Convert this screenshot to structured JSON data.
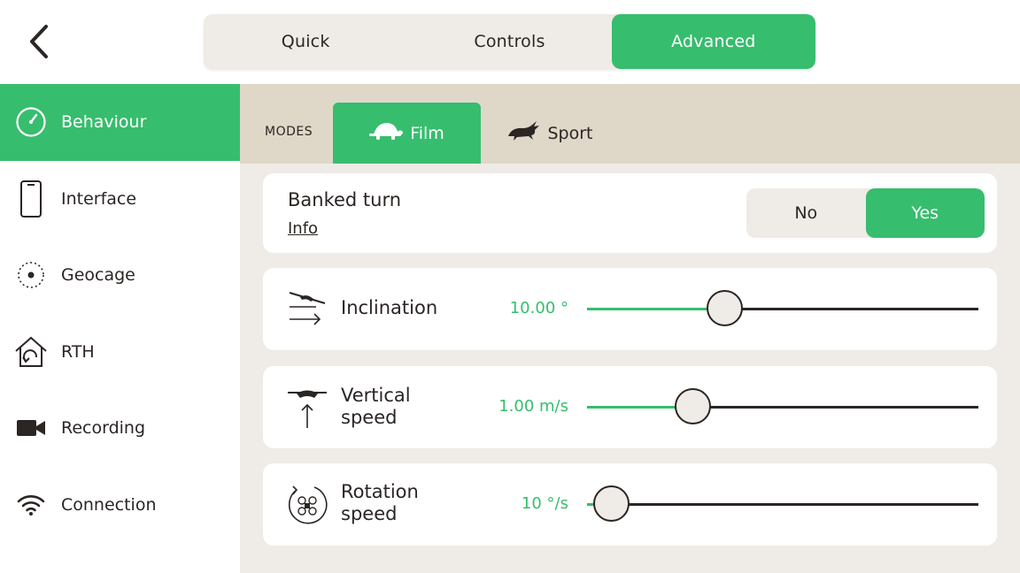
{
  "top_tabs": [
    {
      "label": "Quick",
      "active": false
    },
    {
      "label": "Controls",
      "active": false
    },
    {
      "label": "Advanced",
      "active": true
    }
  ],
  "sidebar": {
    "items": [
      {
        "label": "Behaviour",
        "icon": "gauge-icon",
        "active": true
      },
      {
        "label": "Interface",
        "icon": "phone-icon",
        "active": false
      },
      {
        "label": "Geocage",
        "icon": "geocage-icon",
        "active": false
      },
      {
        "label": "RTH",
        "icon": "home-return-icon",
        "active": false
      },
      {
        "label": "Recording",
        "icon": "video-camera-icon",
        "active": false
      },
      {
        "label": "Connection",
        "icon": "wifi-icon",
        "active": false
      }
    ]
  },
  "modes": {
    "label": "MODES",
    "tabs": [
      {
        "label": "Film",
        "icon": "turtle-icon",
        "active": true
      },
      {
        "label": "Sport",
        "icon": "rabbit-icon",
        "active": false
      }
    ]
  },
  "banked_turn": {
    "title": "Banked turn",
    "info_link": "Info",
    "options": [
      "No",
      "Yes"
    ],
    "selected": "Yes"
  },
  "sliders": [
    {
      "label_line1": "Inclination",
      "label_line2": "",
      "value": "10.00 °",
      "icon": "drone-tilt-icon",
      "fraction": 0.35
    },
    {
      "label_line1": "Vertical",
      "label_line2": "speed",
      "value": "1.00 m/s",
      "icon": "drone-vertical-icon",
      "fraction": 0.27
    },
    {
      "label_line1": "Rotation",
      "label_line2": "speed",
      "value": "10 °/s",
      "icon": "drone-rotation-icon",
      "fraction": 0.06
    }
  ],
  "colors": {
    "accent": "#37bd6e",
    "panel_bg": "#efebe6",
    "modes_bar_bg": "#dfd8c8",
    "text": "#2b2524"
  }
}
